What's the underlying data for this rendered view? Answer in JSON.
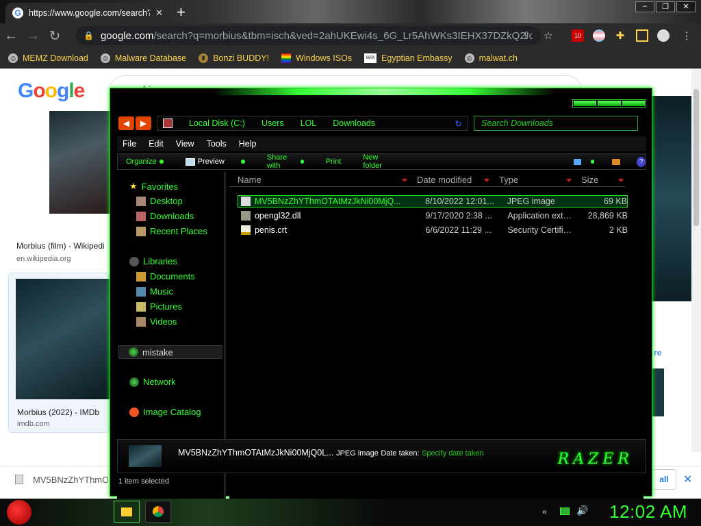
{
  "browser": {
    "tab_title": "https://www.google.com/search?",
    "tab_close": "✕",
    "new_tab": "+",
    "url_domain": "google.com",
    "url_rest": "/search?q=morbius&tbm=isch&ved=2ahUKEwi4s_6G_Lr5AhWKs3IEHX37DZkQ2-cCe...",
    "ext_badge": "10",
    "bookmarks": [
      "MEMZ Download",
      "Malware Database",
      "Bonzi BUDDY!",
      "Windows ISOs",
      "Egyptian Embassy",
      "malwat.ch"
    ]
  },
  "google": {
    "logo": "Google",
    "query": "morbius",
    "results": [
      {
        "caption": "Morbius (film) - Wikipedi",
        "source": "en.wikipedia.org"
      },
      {
        "caption": "Morbius (2022) - IMDb",
        "source": "imdb.com"
      }
    ],
    "right_more": "re",
    "download_name": "MV5BNzZhYThmO..."
  },
  "explorer": {
    "breadcrumb": [
      "Local Disk (C:)",
      "Users",
      "LOL",
      "Downloads"
    ],
    "search_placeholder": "Search Downloads",
    "menu": [
      "File",
      "Edit",
      "View",
      "Tools",
      "Help"
    ],
    "commands": [
      "Organize",
      "Preview",
      "Share with",
      "Print",
      "New folder"
    ],
    "nav": {
      "favorites": "Favorites",
      "favorites_items": [
        "Desktop",
        "Downloads",
        "Recent Places"
      ],
      "libraries": "Libraries",
      "libraries_items": [
        "Documents",
        "Music",
        "Pictures",
        "Videos"
      ],
      "mistake": "mistake",
      "network": "Network",
      "catalog": "Image Catalog"
    },
    "columns": [
      "Name",
      "Date modified",
      "Type",
      "Size"
    ],
    "files": [
      {
        "name": "MV5BNzZhYThmOTAtMzJkNi00MjQ...",
        "date": "8/10/2022 12:01...",
        "type": "JPEG image",
        "size": "69 KB"
      },
      {
        "name": "opengl32.dll",
        "date": "9/17/2020 2:38 ...",
        "type": "Application exte...",
        "size": "28,869 KB"
      },
      {
        "name": "penis.crt",
        "date": "6/6/2022 11:29 ...",
        "type": "Security Certific...",
        "size": "2 KB"
      }
    ],
    "details": {
      "filename": "MV5BNzZhYThmOTAtMzJkNi00MjQ0L...",
      "type": "JPEG image",
      "date_label": "Date taken:",
      "date_value": "Specify date taken"
    },
    "brand": "RAZER",
    "status": "1 item selected"
  },
  "taskbar": {
    "clock": "12:02 AM"
  },
  "colors": {
    "accent": "#33ff33",
    "chrome_bg": "#2b2b2b",
    "bookmark_text": "#fcd34d"
  }
}
